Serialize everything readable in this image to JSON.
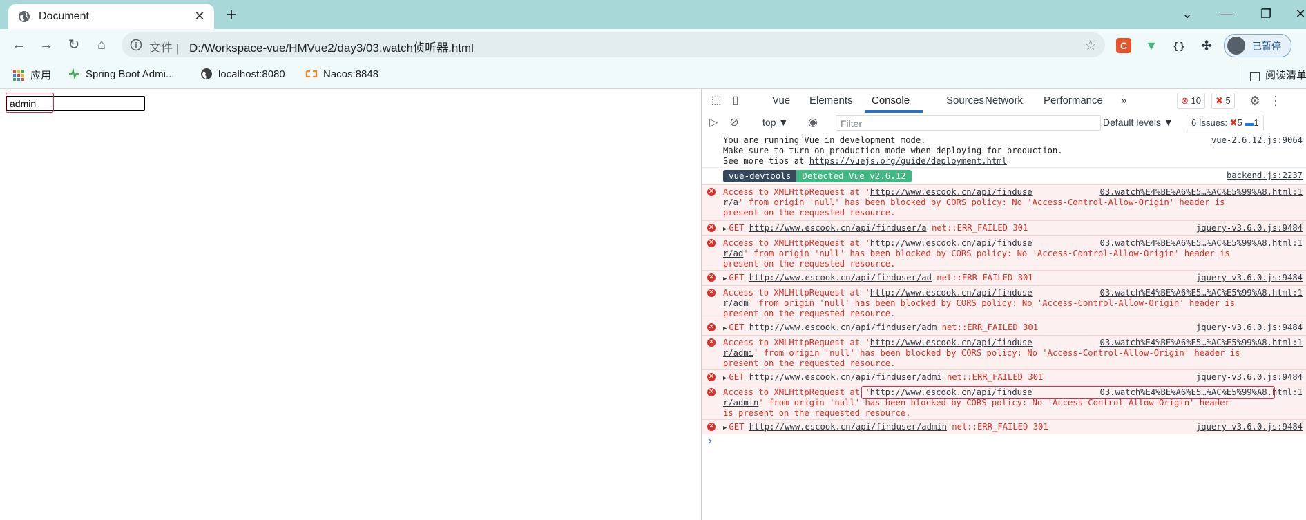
{
  "tab": {
    "title": "Document",
    "close": "✕",
    "new": "+"
  },
  "window": {
    "minimize": "—",
    "restore": "❐",
    "close": "✕",
    "tabsearch": "⌄"
  },
  "address": {
    "scheme": "文件 |",
    "url": "D:/Workspace-vue/HMVue2/day3/03.watch侦听器.html"
  },
  "extensions": [
    {
      "name": "C",
      "color": "#e8542a"
    },
    {
      "name": "▼",
      "color": "#41b883"
    },
    {
      "name": "{ }",
      "color": "#303942"
    }
  ],
  "profile": {
    "label": "已暂停"
  },
  "bookmarks": {
    "apps": "应用",
    "items": [
      "Spring Boot Admi...",
      "localhost:8080",
      "Nacos:8848"
    ],
    "reading": "阅读清单"
  },
  "page": {
    "input_value": "admin"
  },
  "devtools": {
    "tabs": [
      "Vue",
      "Elements",
      "Console",
      "Sources",
      "Network",
      "Performance"
    ],
    "more": "»",
    "errors_count": "10",
    "warnings_count": "5",
    "context": "top ▼",
    "filter_placeholder": "Filter",
    "levels": "Default levels ▼",
    "issues_label": "6 Issues:",
    "issues_red": "5",
    "issues_blue": "1"
  },
  "console": {
    "vue_msg": [
      "You are running Vue in development mode.",
      "Make sure to turn on production mode when deploying for production.",
      "See more tips at "
    ],
    "vue_link": "https://vuejs.org/guide/deployment.html",
    "vue_src": "vue-2.6.12.js:9064",
    "devtools_a": "vue-devtools",
    "devtools_b": "Detected Vue v2.6.12",
    "devtools_src": "backend.js:2237",
    "cors_prefix": "Access to XMLHttpRequest at '",
    "cors_url_base": "http://www.escook.cn/api/finduse",
    "cors_src": "03.watch%E4%BE%A6%E5…%AC%E5%99%A8.html:1",
    "cors_mid": "' from origin 'null' has been blocked by CORS policy: No 'Access-Control-Allow-Origin' header is",
    "cors_end": "present on the requested resource.",
    "get_prefix": "GET ",
    "get_url_base": "http://www.escook.cn/api/finduser/",
    "get_suffix": " net::ERR_FAILED 301",
    "get_src": "jquery-v3.6.0.js:9484",
    "queries": [
      "a",
      "ad",
      "adm",
      "admi",
      "admin"
    ],
    "cors_tails": [
      "r/a",
      "r/ad",
      "r/adm",
      "r/admi",
      "r/admin"
    ],
    "cors_last_mid": "' from origin 'null' has been blocked by CORS policy: No 'Access-Control-Allow-Origin' header",
    "cors_last_end": "is present on the requested resource.",
    "prompt": "›"
  }
}
